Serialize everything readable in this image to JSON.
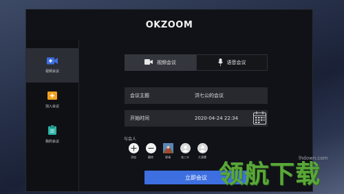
{
  "app": {
    "title": "OKZOOM"
  },
  "sidebar": {
    "items": [
      {
        "label": "视频会议",
        "icon": "video-camera-icon",
        "active": true
      },
      {
        "label": "加入会议",
        "icon": "plus-icon",
        "active": false
      },
      {
        "label": "我的会议",
        "icon": "clipboard-icon",
        "active": false
      }
    ]
  },
  "tabs": [
    {
      "label": "视频会议",
      "icon": "video-camera-icon",
      "active": true
    },
    {
      "label": "语音会议",
      "icon": "microphone-icon",
      "active": false
    }
  ],
  "form": {
    "subject_label": "会议主题",
    "subject_value": "洪七公的会议",
    "start_label": "开始时间",
    "start_value": "2020-04-24 22:34"
  },
  "participants": {
    "title": "与会人",
    "items": [
      {
        "name": "添加",
        "icon": "add-circle-icon"
      },
      {
        "name": "删除",
        "icon": "remove-circle-icon"
      },
      {
        "name": "郭靖",
        "icon": "avatar-photo"
      },
      {
        "name": "张三丰",
        "icon": "avatar-default"
      },
      {
        "name": "大漠鹰",
        "icon": "avatar-default"
      }
    ]
  },
  "actions": {
    "start_label": "立即会议"
  },
  "watermark": {
    "text": "领航下载",
    "url": "lhdown.com"
  },
  "colors": {
    "accent": "#3d6fe0",
    "sidebar_icon": "#3d6fe0",
    "join_icon": "#f0a020",
    "my_icon": "#2bb3a6"
  }
}
